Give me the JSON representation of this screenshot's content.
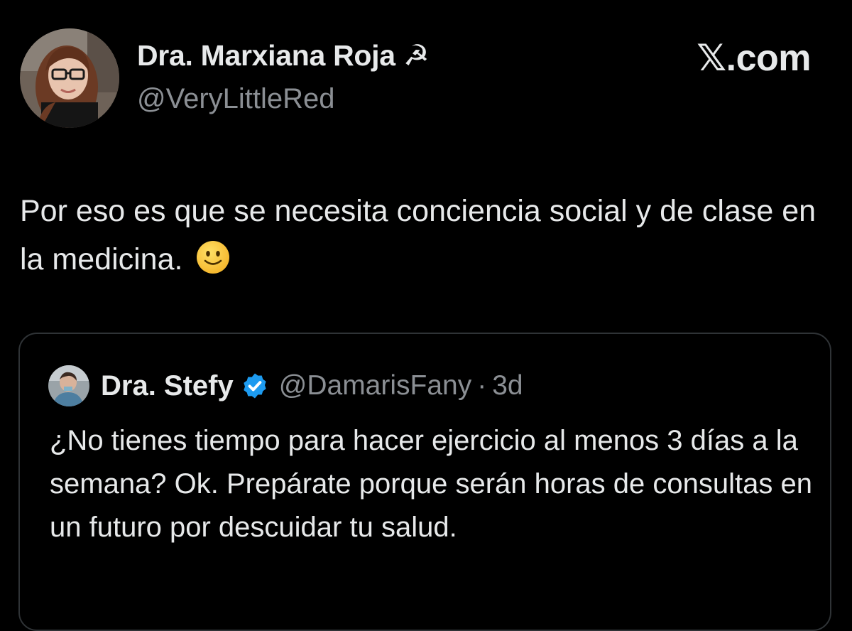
{
  "post": {
    "author": {
      "display_name": "Dra. Marxiana Roja ☭",
      "handle": "@VeryLittleRed",
      "avatar": "profile-photo"
    },
    "source_label": "𝕏.com",
    "text": "Por eso es que se necesita conciencia social y de clase en la medicina.",
    "emoji": "slightly-smiling-face"
  },
  "quoted_post": {
    "author": {
      "display_name": "Dra. Stefy",
      "handle": "@DamarisFany",
      "verified": true,
      "avatar": "profile-photo"
    },
    "separator": "·",
    "time": "3d",
    "text": "¿No tienes tiempo para hacer ejercicio al menos 3 días a la semana? Ok. Prepárate porque serán horas de consultas en un futuro por descuidar tu salud."
  },
  "colors": {
    "background": "#000000",
    "text_primary": "#e7e9ea",
    "text_secondary": "#8b8f94",
    "border": "#2f3336",
    "verified_blue": "#1d9bf0"
  }
}
